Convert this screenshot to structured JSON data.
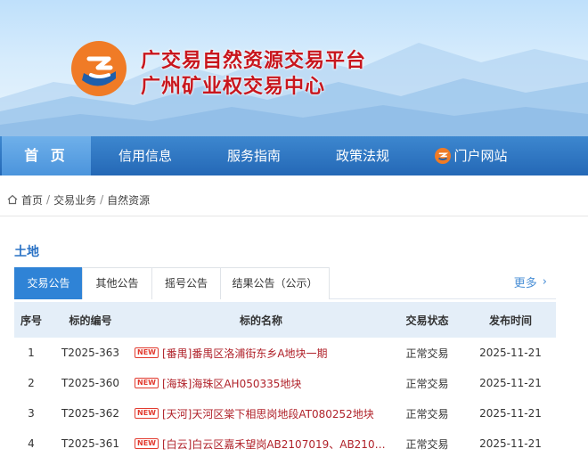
{
  "header": {
    "title_line1": "广交易自然资源交易平台",
    "title_line2": "广州矿业权交易中心"
  },
  "nav": {
    "items": [
      {
        "label": "首 页"
      },
      {
        "label": "信用信息"
      },
      {
        "label": "服务指南"
      },
      {
        "label": "政策法规"
      },
      {
        "label": "门户网站"
      }
    ]
  },
  "breadcrumb": [
    "首页",
    "交易业务",
    "自然资源"
  ],
  "section": {
    "title": "土地",
    "tabs": [
      "交易公告",
      "其他公告",
      "摇号公告",
      "结果公告（公示）"
    ],
    "more": "更多"
  },
  "table": {
    "headers": [
      "序号",
      "标的编号",
      "标的名称",
      "交易状态",
      "发布时间"
    ],
    "rows": [
      {
        "no": "1",
        "code": "T2025-363",
        "name": "[番禺]番禺区洛浦街东乡A地块一期",
        "status": "正常交易",
        "date": "2025-11-21"
      },
      {
        "no": "2",
        "code": "T2025-360",
        "name": "[海珠]海珠区AH050335地块",
        "status": "正常交易",
        "date": "2025-11-21"
      },
      {
        "no": "3",
        "code": "T2025-362",
        "name": "[天河]天河区棠下相思岗地段AT080252地块",
        "status": "正常交易",
        "date": "2025-11-21"
      },
      {
        "no": "4",
        "code": "T2025-361",
        "name": "[白云]白云区嘉禾望岗AB2107019、AB21070...",
        "status": "正常交易",
        "date": "2025-11-21"
      }
    ],
    "new_badge": "NEW"
  },
  "colors": {
    "brand_red": "#c8161d",
    "nav_blue": "#2468b6",
    "accent_blue": "#2f83d6",
    "logo_orange": "#f07b26"
  }
}
